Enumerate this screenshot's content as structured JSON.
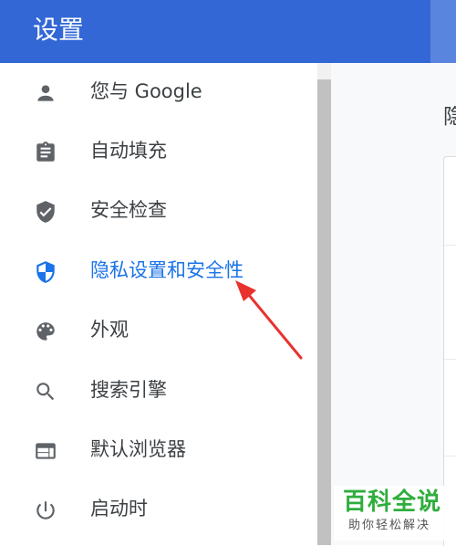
{
  "header": {
    "title": "设置"
  },
  "content": {
    "title": "隐"
  },
  "sidebar": {
    "items": [
      {
        "label": "您与 Google",
        "icon": "person-icon",
        "active": false
      },
      {
        "label": "自动填充",
        "icon": "clipboard-icon",
        "active": false
      },
      {
        "label": "安全检查",
        "icon": "shield-check-icon",
        "active": false
      },
      {
        "label": "隐私设置和安全性",
        "icon": "shield-half-icon",
        "active": true
      },
      {
        "label": "外观",
        "icon": "palette-icon",
        "active": false
      },
      {
        "label": "搜索引擎",
        "icon": "search-icon",
        "active": false
      },
      {
        "label": "默认浏览器",
        "icon": "browser-icon",
        "active": false
      },
      {
        "label": "启动时",
        "icon": "power-icon",
        "active": false
      }
    ]
  },
  "watermark": {
    "main": "百科全说",
    "sub": "助你轻松解决"
  },
  "colors": {
    "header": "#3367d6",
    "active": "#1a73e8",
    "icon": "#5f6368",
    "text": "#3c4043",
    "arrow": "#e8322e",
    "watermark": "#2fae3d"
  }
}
